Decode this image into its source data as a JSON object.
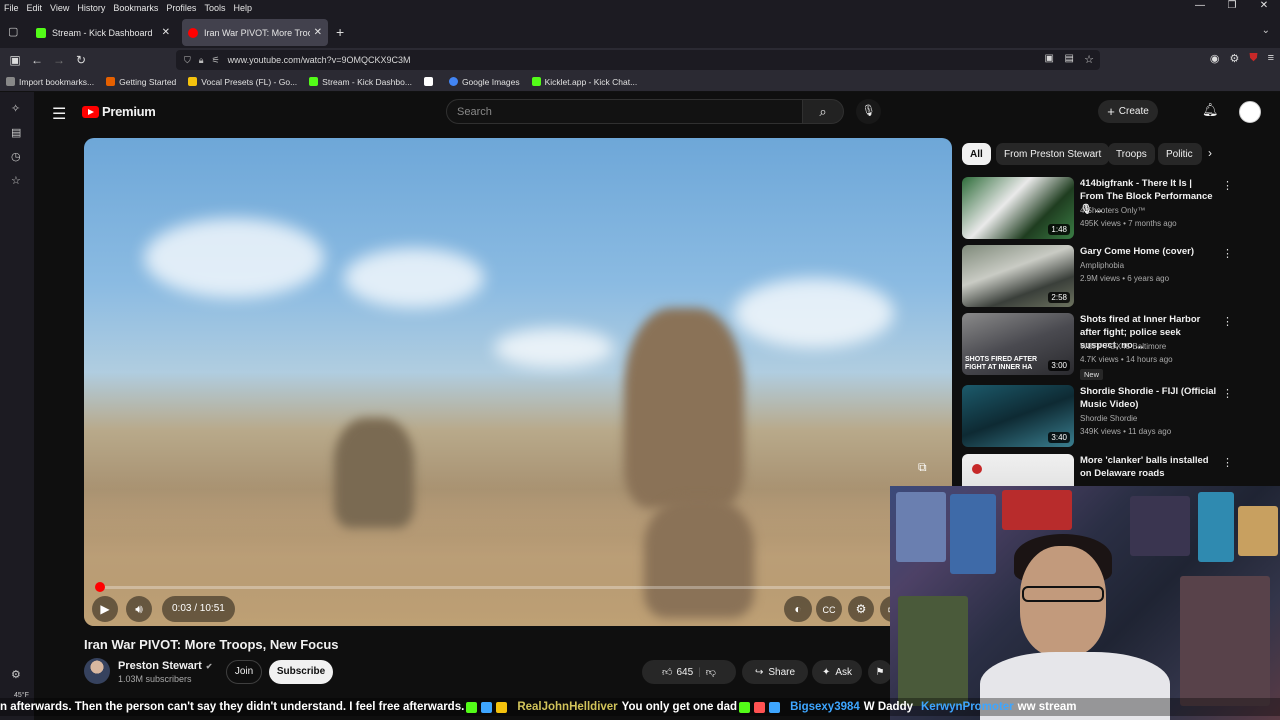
{
  "menubar": [
    "File",
    "Edit",
    "View",
    "History",
    "Bookmarks",
    "Profiles",
    "Tools",
    "Help"
  ],
  "tabs": [
    {
      "title": "Stream - Kick Dashboard",
      "color": "#53fc18"
    },
    {
      "title": "Iran War PIVOT: More Troops, N",
      "color": "#ff0000"
    }
  ],
  "url": "www.youtube.com/watch?v=9OMQCKX9C3M",
  "bookmarks": [
    {
      "label": "Import bookmarks...",
      "color": "#888888"
    },
    {
      "label": "Getting Started",
      "color": "#e66000"
    },
    {
      "label": "Vocal Presets (FL) - Go...",
      "color": "#f4c20d"
    },
    {
      "label": "Stream - Kick Dashbo...",
      "color": "#53fc18"
    },
    {
      "label": "",
      "color": "#ffffff"
    },
    {
      "label": "Google Images",
      "color": "#4285f4"
    },
    {
      "label": "Kicklet.app - Kick Chat...",
      "color": "#53fc18"
    }
  ],
  "youtube": {
    "logo": "Premium",
    "search_placeholder": "Search",
    "create": "Create"
  },
  "player": {
    "time": "0:03 / 10:51",
    "progress_fraction": 0.005
  },
  "video": {
    "title": "Iran War PIVOT: More Troops, New Focus",
    "channel": "Preston Stewart",
    "subscribers": "1.03M subscribers",
    "join": "Join",
    "subscribe": "Subscribe",
    "likes": "645",
    "share": "Share",
    "ask": "Ask"
  },
  "chips": [
    "All",
    "From Preston Stewart",
    "Troops",
    "Politic"
  ],
  "recommendations": [
    {
      "title": "414bigfrank - There It Is | From The Block Performance 🎙 ...",
      "channel": "4 Shooters Only™",
      "meta": "495K views • 7 months ago",
      "duration": "1:48",
      "badge": ""
    },
    {
      "title": "Gary Come Home (cover)",
      "channel": "Ampliphobia",
      "meta": "2.9M views • 6 years ago",
      "duration": "2:58",
      "badge": ""
    },
    {
      "title": "Shots fired at Inner Harbor after fight; police seek suspect, no ...",
      "channel": "WBFF FOX45 Baltimore",
      "meta": "4.7K views • 14 hours ago",
      "duration": "3:00",
      "badge": "New",
      "thumb_text": "SHOTS FIRED AFTER FIGHT AT INNER HA"
    },
    {
      "title": "Shordie Shordie - FIJI (Official Music Video)",
      "channel": "Shordie Shordie",
      "meta": "349K views • 11 days ago",
      "duration": "3:40",
      "badge": ""
    },
    {
      "title": "More 'clanker' balls installed on Delaware roads",
      "channel": "",
      "meta": "",
      "duration": "",
      "badge": ""
    }
  ],
  "ticker": {
    "text1": "n afterwards. Then the person can't say they didn't understand. I feel free afterwards.",
    "user1": "RealJohnHelldiver",
    "msg1": "You only get one dad",
    "user2": "Bigsexy3984",
    "msg2": "W Daddy",
    "user3": "KerwynPromoter",
    "msg3": "ww stream"
  },
  "tray_temp": "45°F"
}
